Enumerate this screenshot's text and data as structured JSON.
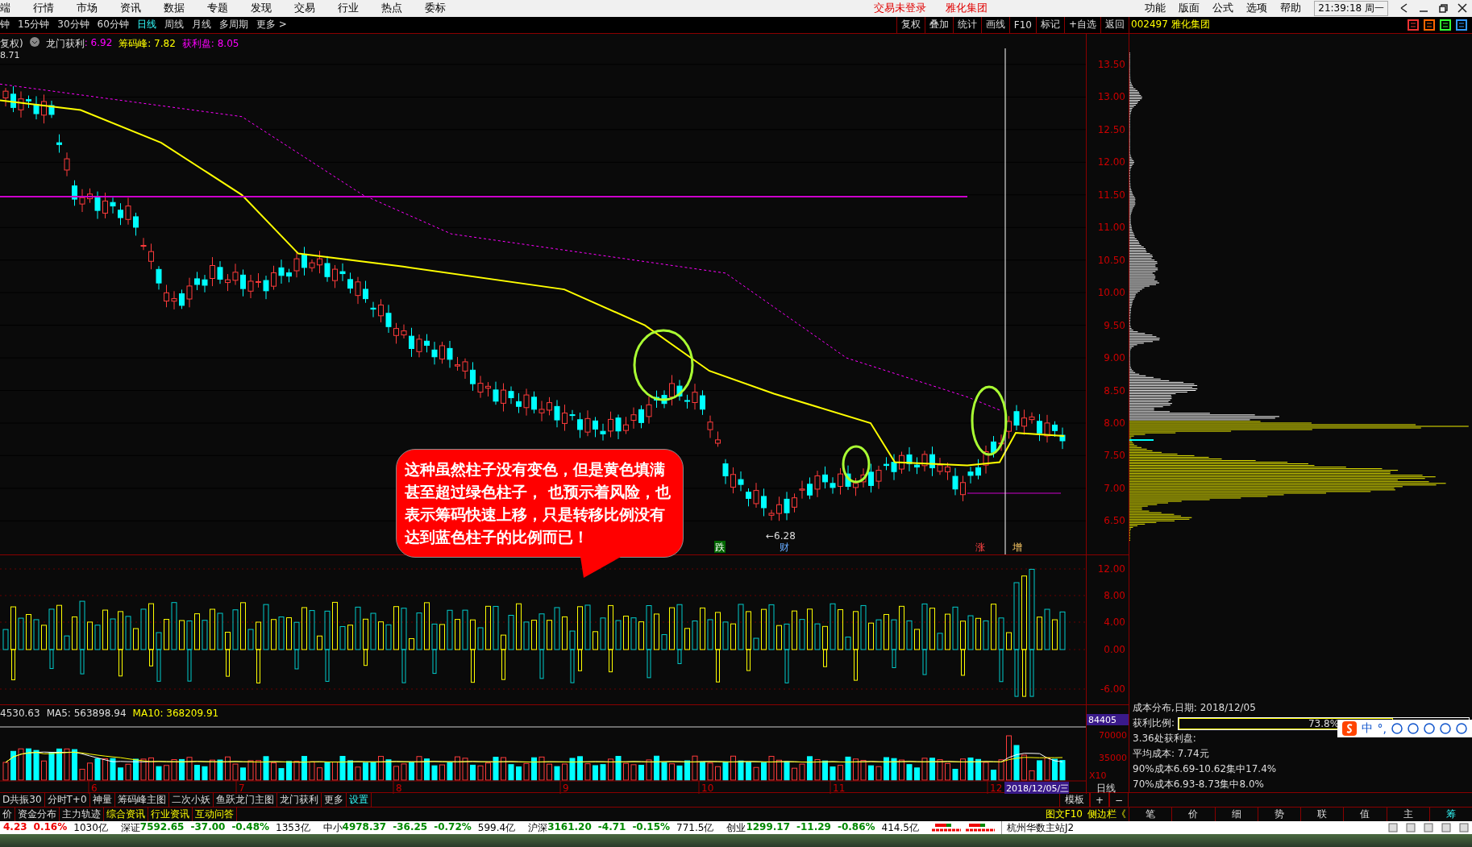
{
  "menu": {
    "items": [
      "端",
      "行情",
      "市场",
      "资讯",
      "数据",
      "专题",
      "发现",
      "交易",
      "行业",
      "热点",
      "委标"
    ],
    "center": [
      "交易未登录",
      "雅化集团"
    ],
    "right": [
      "功能",
      "版面",
      "公式",
      "选项",
      "帮助"
    ],
    "clock": "21:39:18 周一"
  },
  "toolbar": {
    "periods": [
      {
        "label": "钟",
        "selected": false
      },
      {
        "label": "15分钟",
        "selected": false
      },
      {
        "label": "30分钟",
        "selected": false
      },
      {
        "label": "60分钟",
        "selected": false
      },
      {
        "label": "日线",
        "selected": true
      },
      {
        "label": "周线",
        "selected": false
      },
      {
        "label": "月线",
        "selected": false
      },
      {
        "label": "多周期",
        "selected": false
      },
      {
        "label": "更多 >",
        "selected": false
      }
    ],
    "buttons": [
      "复权",
      "叠加",
      "统计",
      "画线",
      "F10",
      "标记",
      "+自选",
      "返回"
    ],
    "stock": "002497 雅化集团"
  },
  "main_chart": {
    "legend": [
      {
        "text": "复权)",
        "kind": "plain"
      },
      {
        "text": "龙门获利",
        "kind": "plain"
      },
      {
        "text": ": 6.92",
        "kind": "magenta"
      },
      {
        "text": "筹码峰: 7.82",
        "kind": "yellow"
      },
      {
        "text": "获利盘: 8.05",
        "kind": "magenta"
      }
    ],
    "top_value": "8.71",
    "price_ticks": [
      "13.50",
      "13.00",
      "12.50",
      "12.00",
      "11.50",
      "11.00",
      "10.50",
      "10.00",
      "9.50",
      "9.00",
      "8.50",
      "8.00",
      "7.50",
      "7.00",
      "6.50"
    ],
    "low_label": "←6.28",
    "signals": [
      {
        "text": "跌",
        "kind": "fall"
      },
      {
        "text": "财",
        "kind": "finance"
      },
      {
        "text": "涨",
        "kind": "rise"
      },
      {
        "text": "增",
        "kind": "increase"
      }
    ],
    "callout": "这种虽然柱子没有变色，但是黄色填满甚至超过绿色柱子， 也预示着风险，也表示筹码快速上移，只是转移比例没有达到蓝色柱子的比例而已！"
  },
  "indicator": {
    "ticks": [
      "12.00",
      "8.00",
      "4.00",
      "0.00",
      "-6.00"
    ]
  },
  "volume": {
    "legend": [
      {
        "text": "4530.63",
        "kind": "plain"
      },
      {
        "text": "MA5: 563898.94",
        "kind": "plain"
      },
      {
        "text": "MA10: 368209.91",
        "kind": "yellow"
      }
    ],
    "current": "84405",
    "ticks": [
      "70000",
      "35000"
    ],
    "scale": "X10",
    "dates": [
      "6",
      "7",
      "8",
      "9",
      "10",
      "11",
      "12"
    ],
    "cursor_date": "2018/12/05/三",
    "period": "日线"
  },
  "chip": {
    "date": "成本分布,日期: 2018/12/05",
    "ratio_label": "获利比例:",
    "ratio": "73.8%",
    "level": 0.738,
    "lines": [
      "3.36处获利盘:",
      "平均成本: 7.74元",
      "90%成本6.69-10.62集中17.4%",
      "70%成本6.93-8.73集中8.0%"
    ],
    "tabs": [
      {
        "label": "笔",
        "selected": false
      },
      {
        "label": "价",
        "selected": false
      },
      {
        "label": "细",
        "selected": false
      },
      {
        "label": "势",
        "selected": false
      },
      {
        "label": "联",
        "selected": false
      },
      {
        "label": "值",
        "selected": false
      },
      {
        "label": "主",
        "selected": false
      },
      {
        "label": "筹",
        "selected": true
      }
    ]
  },
  "ime": [
    "中",
    "°,"
  ],
  "bottom_tabs": [
    {
      "label": "D共振30",
      "kind": "plain"
    },
    {
      "label": "分时T+0",
      "kind": "plain"
    },
    {
      "label": "神量",
      "kind": "plain"
    },
    {
      "label": "筹码峰主图",
      "kind": "plain"
    },
    {
      "label": "二次小妖",
      "kind": "plain"
    },
    {
      "label": "鱼跃龙门主图",
      "kind": "plain"
    },
    {
      "label": "龙门获利",
      "kind": "plain"
    },
    {
      "label": "更多",
      "kind": "plain"
    },
    {
      "label": "设置",
      "kind": "setting"
    }
  ],
  "template_controls": [
    "模板",
    "+",
    "−"
  ],
  "info_tabs": [
    {
      "label": "价",
      "kind": "plain"
    },
    {
      "label": "资金分布",
      "kind": "plain"
    },
    {
      "label": "主力轨迹",
      "kind": "plain"
    },
    {
      "label": "综合资讯",
      "kind": "info"
    },
    {
      "label": "行业资讯",
      "kind": "info"
    },
    {
      "label": "互动问答",
      "kind": "info"
    }
  ],
  "side_links": [
    "图文F10",
    "侧边栏《"
  ],
  "status_bar": {
    "indices": [
      {
        "value": "4.23",
        "pct": "0.16%",
        "amount": "1030亿",
        "kind": "up"
      },
      {
        "name": "深证",
        "value": "7592.65",
        "change": "-37.00",
        "pct": "-0.48%",
        "amount": "1353亿",
        "kind": "down"
      },
      {
        "name": "中小",
        "value": "4978.37",
        "change": "-36.25",
        "pct": "-0.72%",
        "amount": "599.4亿",
        "kind": "down"
      },
      {
        "name": "沪深",
        "value": "3161.20",
        "change": "-4.71",
        "pct": "-0.15%",
        "amount": "771.5亿",
        "kind": "down"
      },
      {
        "name": "创业",
        "value": "1299.17",
        "change": "-11.29",
        "pct": "-0.86%",
        "amount": "414.5亿",
        "kind": "down"
      }
    ],
    "server": "杭州华数主站J2"
  }
}
